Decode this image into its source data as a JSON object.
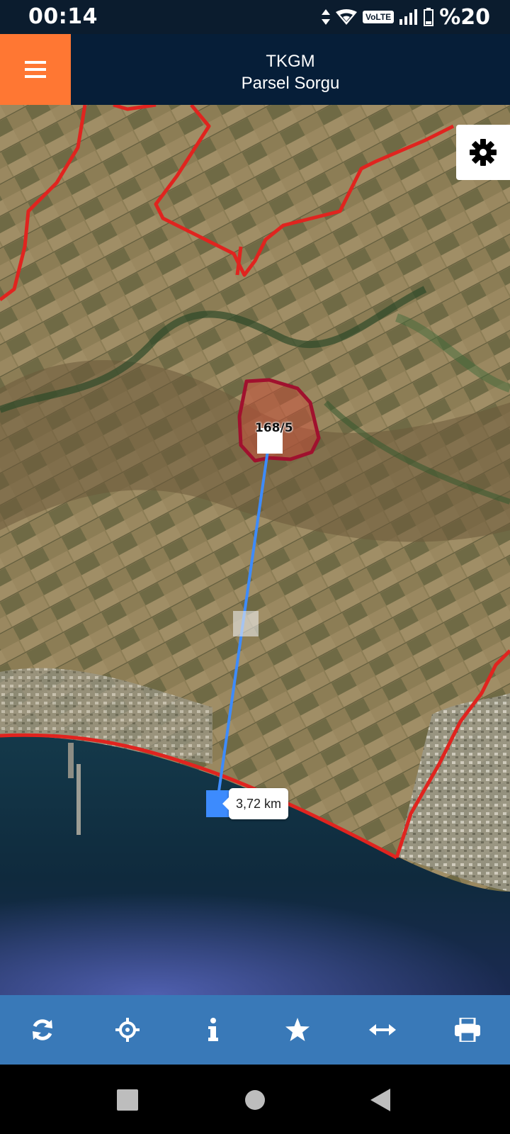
{
  "status_bar": {
    "time": "00:14",
    "network_badge": "VoLTE",
    "battery": "%20",
    "icons": [
      "data-arrows-icon",
      "wifi-icon",
      "signal-icon",
      "battery-icon"
    ]
  },
  "header": {
    "title": "TKGM",
    "subtitle": "Parsel Sorgu",
    "menu_icon": "hamburger-menu-icon",
    "menu_color": "#ff7733",
    "background": "#061e38"
  },
  "map": {
    "parcel_label": "168/5",
    "distance": "3,72 km",
    "settings_icon": "gear-icon",
    "boundary_color": "#e0241f",
    "parcel_color": "#a0112e",
    "measure_line_color": "#3d8bfd"
  },
  "toolbar": {
    "background": "#3979b8",
    "buttons": [
      {
        "name": "refresh",
        "icon": "refresh-icon"
      },
      {
        "name": "locate",
        "icon": "crosshair-icon"
      },
      {
        "name": "info",
        "icon": "info-icon"
      },
      {
        "name": "favorites",
        "icon": "star-icon"
      },
      {
        "name": "measure",
        "icon": "horizontal-arrows-icon"
      },
      {
        "name": "print",
        "icon": "print-icon"
      }
    ]
  },
  "nav_bar": {
    "buttons": [
      "recent-apps",
      "home",
      "back"
    ]
  }
}
